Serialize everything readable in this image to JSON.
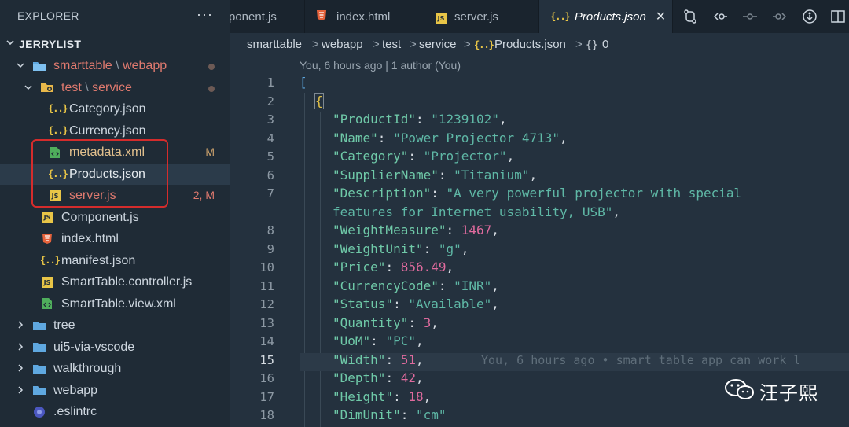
{
  "sidebar": {
    "title": "EXPLORER",
    "more": "···",
    "root": "JERRYLIST",
    "items": [
      {
        "label": "smarttable",
        "label2": "webapp",
        "sep": "\\",
        "type": "folder-open",
        "badge": "",
        "dot": true
      },
      {
        "label": "test",
        "label2": "service",
        "sep": "\\",
        "type": "folder-gear",
        "badge": "",
        "dot": true
      },
      {
        "label": "Category.json",
        "type": "json",
        "badge": ""
      },
      {
        "label": "Currency.json",
        "type": "json",
        "badge": ""
      },
      {
        "label": "metadata.xml",
        "type": "xml",
        "badge": "M"
      },
      {
        "label": "Products.json",
        "type": "json",
        "badge": ""
      },
      {
        "label": "server.js",
        "type": "js",
        "badge": "2, M"
      },
      {
        "label": "Component.js",
        "type": "js",
        "badge": ""
      },
      {
        "label": "index.html",
        "type": "html",
        "badge": ""
      },
      {
        "label": "manifest.json",
        "type": "json",
        "badge": ""
      },
      {
        "label": "SmartTable.controller.js",
        "type": "js",
        "badge": ""
      },
      {
        "label": "SmartTable.view.xml",
        "type": "xml",
        "badge": ""
      },
      {
        "label": "tree",
        "type": "folder",
        "badge": ""
      },
      {
        "label": "ui5-via-vscode",
        "type": "folder",
        "badge": ""
      },
      {
        "label": "walkthrough",
        "type": "folder",
        "badge": ""
      },
      {
        "label": "webapp",
        "type": "folder",
        "badge": ""
      },
      {
        "label": ".eslintrc",
        "type": "eslint",
        "badge": ""
      }
    ]
  },
  "tabs": [
    {
      "label": "ponent.js",
      "type": "none"
    },
    {
      "label": "index.html",
      "type": "html"
    },
    {
      "label": "server.js",
      "type": "js"
    },
    {
      "label": "Products.json",
      "type": "json",
      "active": true
    }
  ],
  "tab_close": "✕",
  "breadcrumb": {
    "p1": "smarttable",
    "p2": "webapp",
    "p3": "test",
    "p4": "service",
    "file": "Products.json",
    "node": "0",
    "sep": ">"
  },
  "codelens": "You, 6 hours ago | 1 author (You)",
  "line_numbers": [
    "1",
    "2",
    "3",
    "4",
    "5",
    "6",
    "7",
    "",
    "8",
    "9",
    "10",
    "11",
    "12",
    "13",
    "14",
    "15",
    "16",
    "17",
    "18"
  ],
  "code": {
    "l1": "[",
    "l2": "{",
    "l3k": "\"ProductId\"",
    "l3v": "\"1239102\"",
    "l4k": "\"Name\"",
    "l4v": "\"Power Projector 4713\"",
    "l5k": "\"Category\"",
    "l5v": "\"Projector\"",
    "l6k": "\"SupplierName\"",
    "l6v": "\"Titanium\"",
    "l7k": "\"Description\"",
    "l7v": "\"A very powerful projector with special",
    "l7b": "features for Internet usability, USB\"",
    "l8k": "\"WeightMeasure\"",
    "l8v": "1467",
    "l9k": "\"WeightUnit\"",
    "l9v": "\"g\"",
    "l10k": "\"Price\"",
    "l10v": "856.49",
    "l11k": "\"CurrencyCode\"",
    "l11v": "\"INR\"",
    "l12k": "\"Status\"",
    "l12v": "\"Available\"",
    "l13k": "\"Quantity\"",
    "l13v": "3",
    "l14k": "\"UoM\"",
    "l14v": "\"PC\"",
    "l15k": "\"Width\"",
    "l15v": "51",
    "l15blame": "You, 6 hours ago • smart table app can work l",
    "l16k": "\"Depth\"",
    "l16v": "42",
    "l17k": "\"Height\"",
    "l17v": "18",
    "l18k": "\"DimUnit\"",
    "l18v": "\"cm\""
  },
  "watermark": "汪子熙",
  "colors": {
    "sidebar_bg": "#1f2b36",
    "editor_bg": "#24313e",
    "highlight_box": "#d42c2c",
    "json_key": "#6fc9a8",
    "json_number": "#e06b9e"
  }
}
